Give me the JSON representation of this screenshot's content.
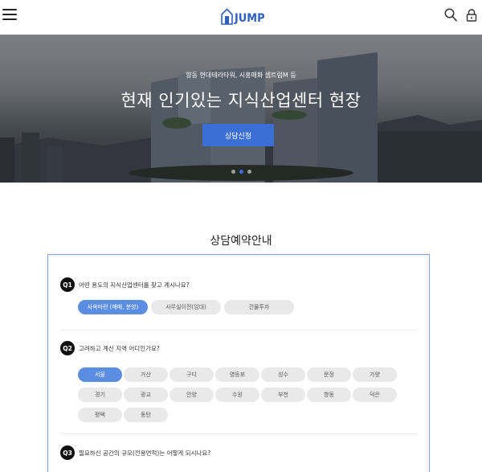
{
  "header": {
    "logo_text": "JUMP",
    "menu_icon": "hamburger-icon",
    "search_icon": "search-icon",
    "lock_icon": "lock-icon",
    "brand_color": "#2f5fbf"
  },
  "hero": {
    "subtitle": "향동 현대테라타워, 시흥매화 셈트럼M 등",
    "title": "현재 인기있는 지식산업센터 현장",
    "button_label": "상담신청",
    "slide_count": 3,
    "active_slide": 2,
    "accent_color": "#3b6fd6"
  },
  "section": {
    "title": "상담예약안내"
  },
  "questions": [
    {
      "number": "Q1",
      "text": "어떤 용도의 지식산업센터를 찾고 계시나요?",
      "options": [
        "사옥마련 (매매, 분양)",
        "사무실이전(임대)",
        "건물투자"
      ],
      "selected": 0
    },
    {
      "number": "Q2",
      "text": "고려하고 계신 지역 어디인가요?",
      "options": [
        "서울",
        "가산",
        "구디",
        "영등포",
        "성수",
        "문정",
        "가양",
        "경기",
        "광교",
        "안양",
        "수원",
        "부천",
        "향동",
        "덕은",
        "평택",
        "동탄"
      ],
      "selected": 0
    },
    {
      "number": "Q3",
      "text": "필요하신 공간의 규모(전용면적)는 어떻게 되시나요?",
      "options": [
        "",
        "",
        ""
      ],
      "selected": 0
    }
  ],
  "colors": {
    "option_selected": "#5b8ee2",
    "option_default": "#e9e9e9",
    "card_border": "#7a9fe3"
  }
}
